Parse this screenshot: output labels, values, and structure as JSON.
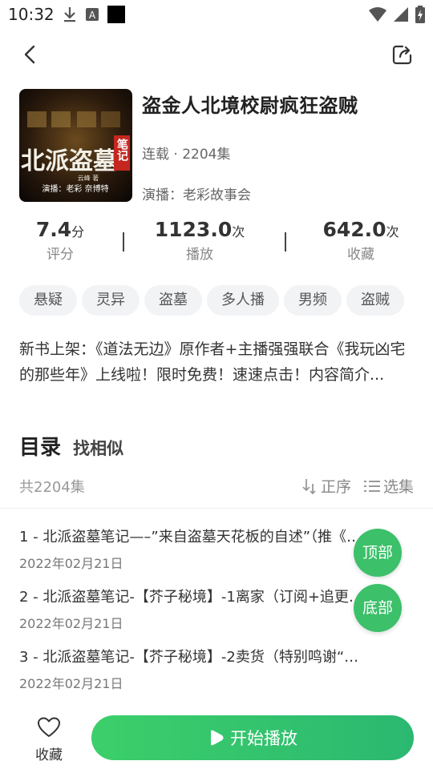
{
  "status_bar": {
    "time": "10:32",
    "left_icons": [
      "download-icon",
      "a-icon",
      "black-square-icon"
    ],
    "right_icons": [
      "wifi-icon",
      "signal-icon",
      "battery-icon"
    ]
  },
  "nav": {
    "back_icon": "chevron-left-icon",
    "share_icon": "share-icon"
  },
  "book": {
    "title": "盗金人北境校尉疯狂盗贼",
    "meta": "连载 · 2204集",
    "anchor": "演播：老彩故事会",
    "cover_text": {
      "main": "北派盗墓",
      "side": "笔记",
      "author": "云峰 著",
      "reader": "演播：老彩 奈博特"
    }
  },
  "stats": [
    {
      "value": "7.4",
      "unit": "分",
      "label": "评分"
    },
    {
      "value": "1123.0",
      "unit": "次",
      "label": "播放"
    },
    {
      "value": "642.0",
      "unit": "次",
      "label": "收藏"
    }
  ],
  "tags": [
    "悬疑",
    "灵异",
    "盗墓",
    "多人播",
    "男频",
    "盗贼"
  ],
  "description": "新书上架：《道法无边》原作者+主播强强联合《我玩凶宅的那些年》上线啦！限时免费！速速点击！内容简介...",
  "toc": {
    "title": "目录",
    "similar": "找相似",
    "count": "共2204集",
    "sort_label": "正序",
    "select_label": "选集"
  },
  "episodes": [
    {
      "title": "1 - 北派盗墓笔记—–”来自盗墓天花板的自述”（推《…",
      "date": "2022年02月21日"
    },
    {
      "title": "2 - 北派盗墓笔记-【芥子秘境】-1离家（订阅+追更…",
      "date": "2022年02月21日"
    },
    {
      "title": "3 - 北派盗墓笔记-【芥子秘境】-2卖货（特别鸣谢“…",
      "date": "2022年02月21日"
    }
  ],
  "float_buttons": {
    "top": "顶部",
    "bottom": "底部"
  },
  "bottom": {
    "fav_label": "收藏",
    "play_label": "开始播放"
  },
  "colors": {
    "accent_green": "#3cc06a",
    "tag_bg": "#f2f3f5"
  }
}
